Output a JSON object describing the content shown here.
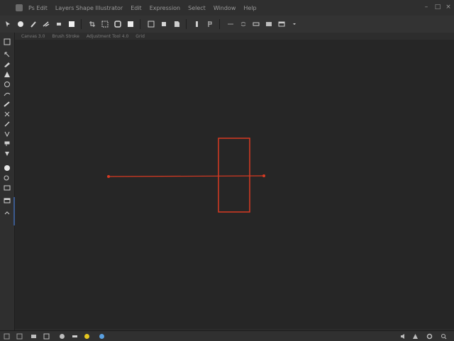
{
  "titlebar": {
    "menu": [
      "Ps Edit",
      "Layers Shape Illustrator",
      "Edit",
      "Expression",
      "",
      "Select",
      "Window",
      "Help"
    ]
  },
  "toolbar": {
    "buttons": [
      "move-tool",
      "ellipse",
      "pen",
      "brush-options",
      "eraser",
      "rectangle",
      "crop",
      "selection",
      "marquee",
      "fill",
      "frame",
      "layer",
      "doc",
      "align-left",
      "pen-2",
      "transform",
      "direction",
      "link",
      "panel-toggle",
      "panel-a",
      "panel-b",
      "more"
    ]
  },
  "tabbar": {
    "tabs": [
      "Canvas  3.0",
      "Brush Stroke",
      "Adjustment Tool 4.0",
      "Grid"
    ]
  },
  "tools": [
    "frame-tool",
    "move-tool",
    "brush-tool",
    "pen-tool",
    "fill-tool",
    "lasso-tool",
    "brush-2-tool",
    "cut-tool",
    "eyedropper-tool",
    "crop-tool",
    "stamp-tool",
    "shape-tool",
    "ellipse-tool",
    "text-tool",
    "window-tool",
    "layer-tool",
    "collapse-tool"
  ],
  "drawing": {
    "stroke_color": "#d83a22",
    "line_label": "",
    "rect_label": ""
  },
  "status": {
    "left_icons": [
      "layers",
      "frame",
      "image",
      "mask",
      "blend",
      "light",
      "clock",
      "globe"
    ],
    "right_icons": [
      "sound",
      "warning",
      "settings",
      "zoom"
    ]
  }
}
